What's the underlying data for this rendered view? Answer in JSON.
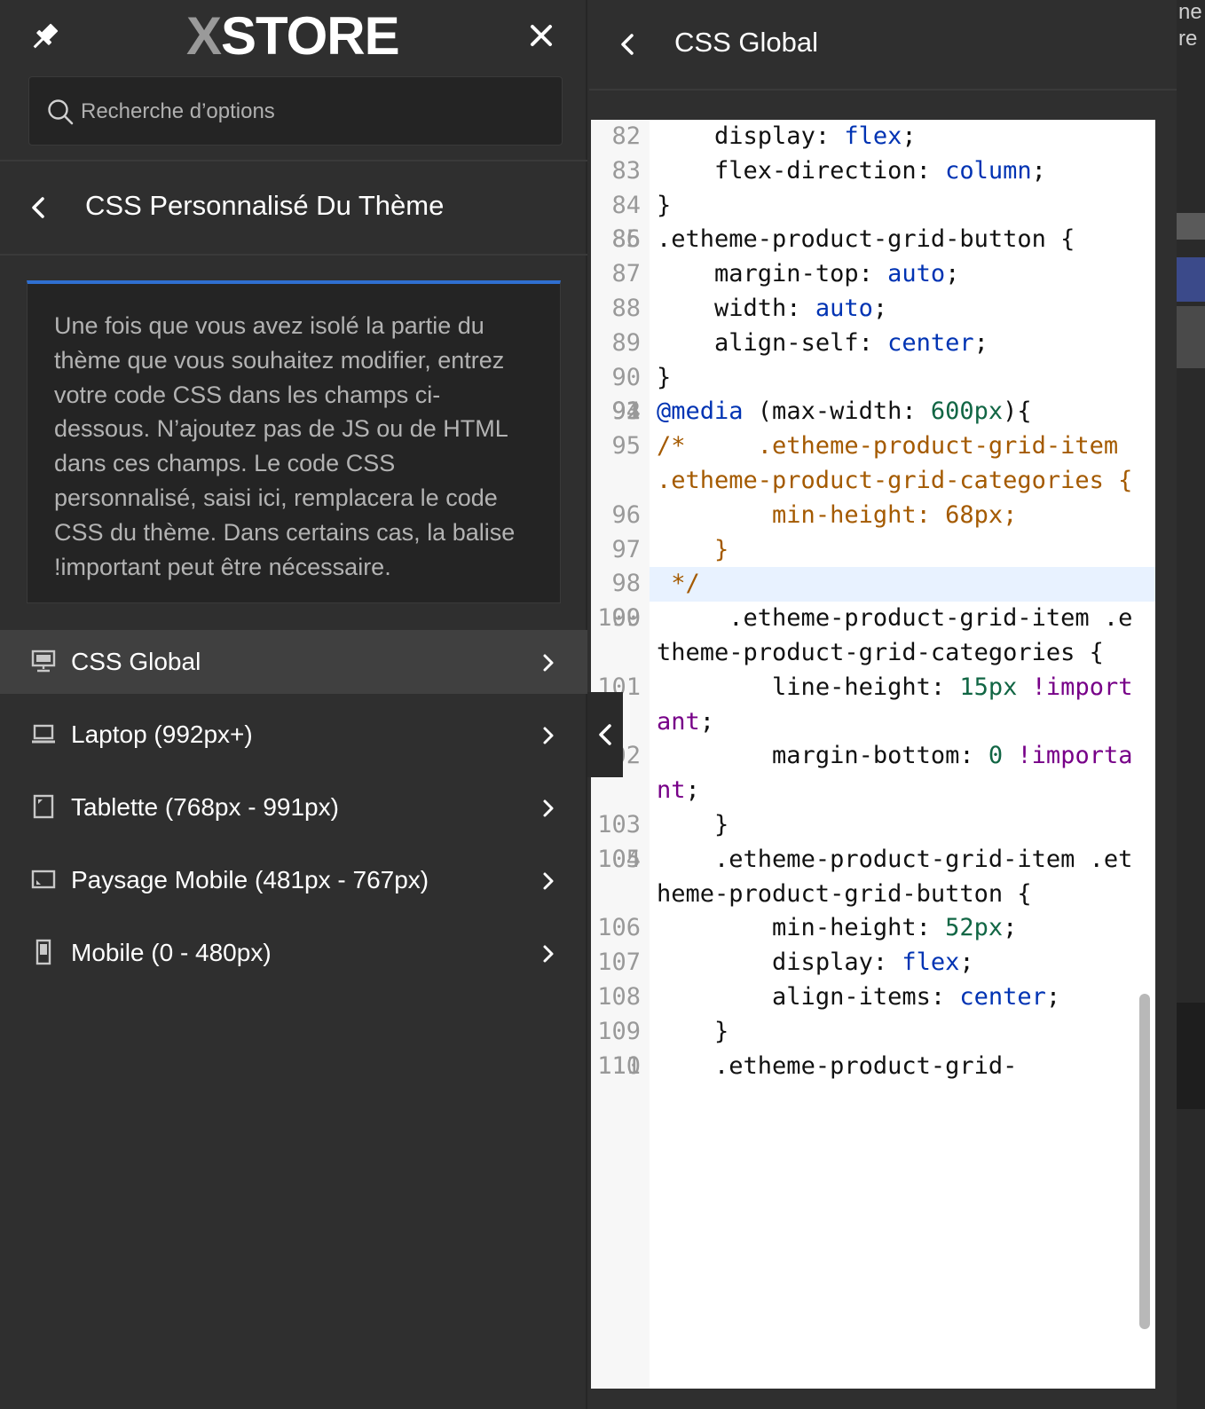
{
  "header": {
    "logo_mark": "X",
    "logo_text": "STORE",
    "pin_icon": "pin-icon",
    "close_icon": "close-icon"
  },
  "search": {
    "placeholder": "Recherche d’options",
    "value": "",
    "icon": "search-icon"
  },
  "section": {
    "title": "CSS Personnalisé Du Thème",
    "back_icon": "chevron-left-icon"
  },
  "notice": {
    "text": "Une fois que vous avez isolé la partie du thème que vous souhaitez modifier, entrez votre code CSS dans les champs ci-dessous. N’ajoutez pas de JS ou de HTML dans ces champs. Le code CSS personnalisé, saisi ici, remplacera le code CSS du thème. Dans certains cas, la balise !important peut être nécessaire.",
    "accent_color": "#2f6fd0"
  },
  "devices": [
    {
      "label": "CSS Global",
      "icon": "desktop-icon",
      "active": true
    },
    {
      "label": "Laptop (992px+)",
      "icon": "laptop-icon",
      "active": false
    },
    {
      "label": "Tablette (768px - 991px)",
      "icon": "tablet-icon",
      "active": false
    },
    {
      "label": "Paysage Mobile (481px - 767px)",
      "icon": "mobile-landscape-icon",
      "active": false
    },
    {
      "label": "Mobile (0 - 480px)",
      "icon": "mobile-icon",
      "active": false
    }
  ],
  "panel": {
    "title": "CSS Global",
    "back_icon": "chevron-left-icon"
  },
  "editor": {
    "active_line": 98,
    "lines": [
      {
        "n": 82,
        "parts": [
          [
            "",
            "    display: "
          ],
          [
            "kw",
            "flex"
          ],
          [
            "",
            ";"
          ]
        ]
      },
      {
        "n": 83,
        "parts": [
          [
            "",
            "    flex-direction: "
          ],
          [
            "kw",
            "column"
          ],
          [
            "",
            ";"
          ]
        ]
      },
      {
        "n": 84,
        "parts": [
          [
            "",
            "}"
          ]
        ]
      },
      {
        "n": 85,
        "parts": [
          [
            "",
            ""
          ]
        ]
      },
      {
        "n": 86,
        "parts": [
          [
            "",
            ".etheme-product-grid-button {"
          ]
        ]
      },
      {
        "n": 87,
        "parts": [
          [
            "",
            "    margin-top: "
          ],
          [
            "kw",
            "auto"
          ],
          [
            "",
            ";"
          ]
        ]
      },
      {
        "n": 88,
        "parts": [
          [
            "",
            "    width: "
          ],
          [
            "kw",
            "auto"
          ],
          [
            "",
            ";"
          ]
        ]
      },
      {
        "n": 89,
        "parts": [
          [
            "",
            "    align-self: "
          ],
          [
            "kw",
            "center"
          ],
          [
            "",
            ";"
          ]
        ]
      },
      {
        "n": 90,
        "parts": [
          [
            "",
            "}"
          ]
        ]
      },
      {
        "n": 91,
        "parts": [
          [
            "",
            ""
          ]
        ]
      },
      {
        "n": 92,
        "parts": [
          [
            "",
            ""
          ]
        ]
      },
      {
        "n": 93,
        "parts": [
          [
            "",
            ""
          ]
        ]
      },
      {
        "n": 94,
        "parts": [
          [
            "at",
            "@media"
          ],
          [
            "",
            " (max-width: "
          ],
          [
            "num",
            "600px"
          ],
          [
            "",
            "){"
          ]
        ]
      },
      {
        "n": 95,
        "parts": [
          [
            "com",
            "/*     .etheme-product-grid-item .etheme-product-grid-categories {"
          ]
        ]
      },
      {
        "n": 96,
        "parts": [
          [
            "com",
            "        min-height: 68px;"
          ]
        ]
      },
      {
        "n": 97,
        "parts": [
          [
            "com",
            "    }"
          ]
        ]
      },
      {
        "n": 98,
        "parts": [
          [
            "com",
            " */"
          ]
        ]
      },
      {
        "n": 99,
        "parts": [
          [
            "",
            ""
          ]
        ]
      },
      {
        "n": 100,
        "parts": [
          [
            "",
            "     .etheme-product-grid-item .etheme-product-grid-categories {"
          ]
        ]
      },
      {
        "n": 101,
        "parts": [
          [
            "",
            "        line-height: "
          ],
          [
            "num",
            "15px"
          ],
          [
            "",
            " "
          ],
          [
            "imp",
            "!important"
          ],
          [
            "",
            ";"
          ]
        ]
      },
      {
        "n": 102,
        "parts": [
          [
            "",
            "        margin-bottom: "
          ],
          [
            "num",
            "0"
          ],
          [
            "",
            " "
          ],
          [
            "imp",
            "!important"
          ],
          [
            "",
            ";"
          ]
        ]
      },
      {
        "n": 103,
        "parts": [
          [
            "",
            "    }"
          ]
        ]
      },
      {
        "n": 104,
        "parts": [
          [
            "",
            ""
          ]
        ]
      },
      {
        "n": 105,
        "parts": [
          [
            "",
            "    .etheme-product-grid-item .etheme-product-grid-button {"
          ]
        ]
      },
      {
        "n": 106,
        "parts": [
          [
            "",
            "        min-height: "
          ],
          [
            "num",
            "52px"
          ],
          [
            "",
            ";"
          ]
        ]
      },
      {
        "n": 107,
        "parts": [
          [
            "",
            "        display: "
          ],
          [
            "kw",
            "flex"
          ],
          [
            "",
            ";"
          ]
        ]
      },
      {
        "n": 108,
        "parts": [
          [
            "",
            "        align-items: "
          ],
          [
            "kw",
            "center"
          ],
          [
            "",
            ";"
          ]
        ]
      },
      {
        "n": 109,
        "parts": [
          [
            "",
            "    }"
          ]
        ]
      },
      {
        "n": 110,
        "parts": [
          [
            "",
            ""
          ]
        ]
      },
      {
        "n": 111,
        "parts": [
          [
            "",
            "    .etheme-product-grid-"
          ]
        ]
      }
    ]
  },
  "preview_edge": {
    "fragments": [
      "ne",
      "re"
    ]
  }
}
